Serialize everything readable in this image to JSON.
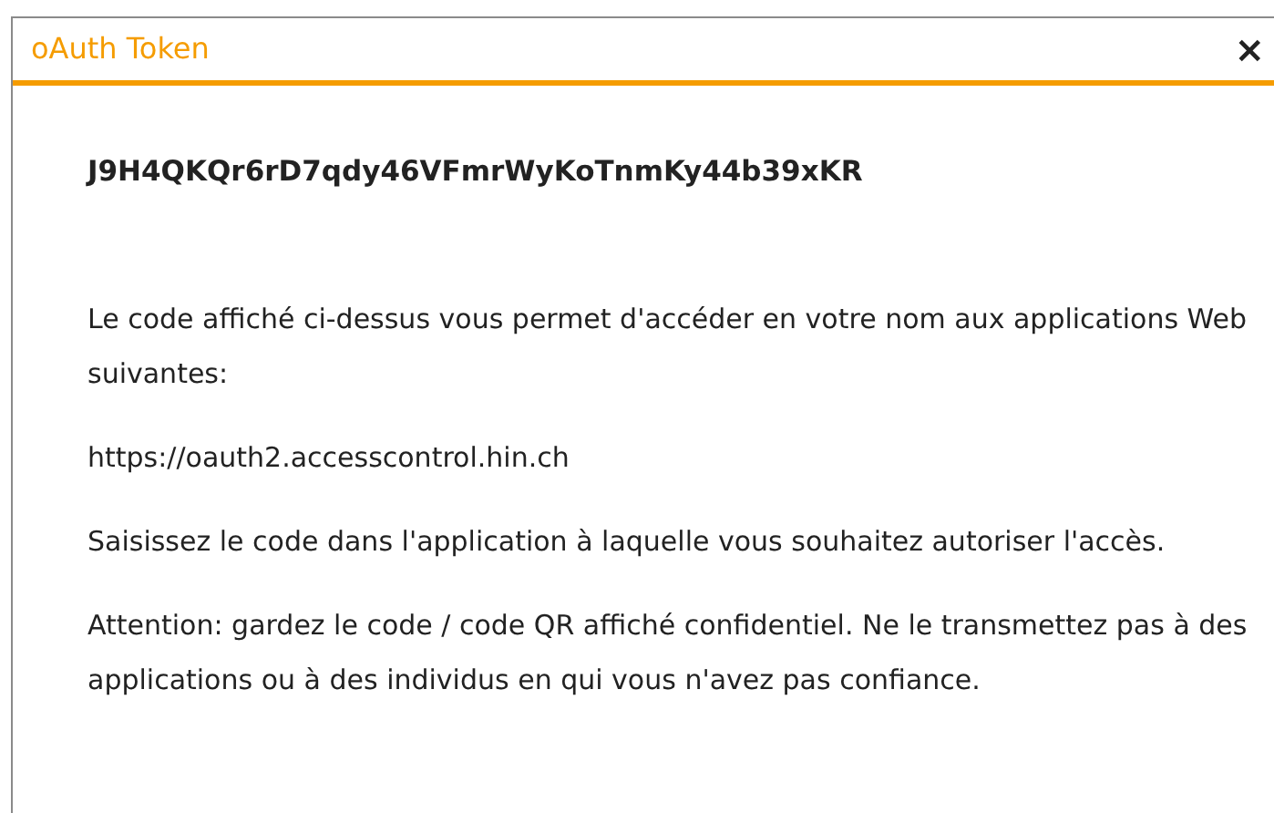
{
  "dialog": {
    "title": "oAuth Token",
    "close": "×"
  },
  "token": "J9H4QKQr6rD7qdy46VFmrWyKoTnmKy44b39xKR",
  "paragraphs": [
    {
      "kind": "text",
      "text": "Le code affiché ci-dessus vous permet d'accéder en votre nom aux applications Web suivantes:"
    },
    {
      "kind": "url",
      "text": "https://oauth2.accesscontrol.hin.ch"
    },
    {
      "kind": "text",
      "text": "Saisissez le code dans l'application à laquelle vous souhaitez autoriser l'accès."
    },
    {
      "kind": "text",
      "text": "Attention: gardez le code / code QR affiché confidentiel. Ne le transmettez pas à des applications ou à des individus en qui vous n'avez pas confiance."
    }
  ]
}
